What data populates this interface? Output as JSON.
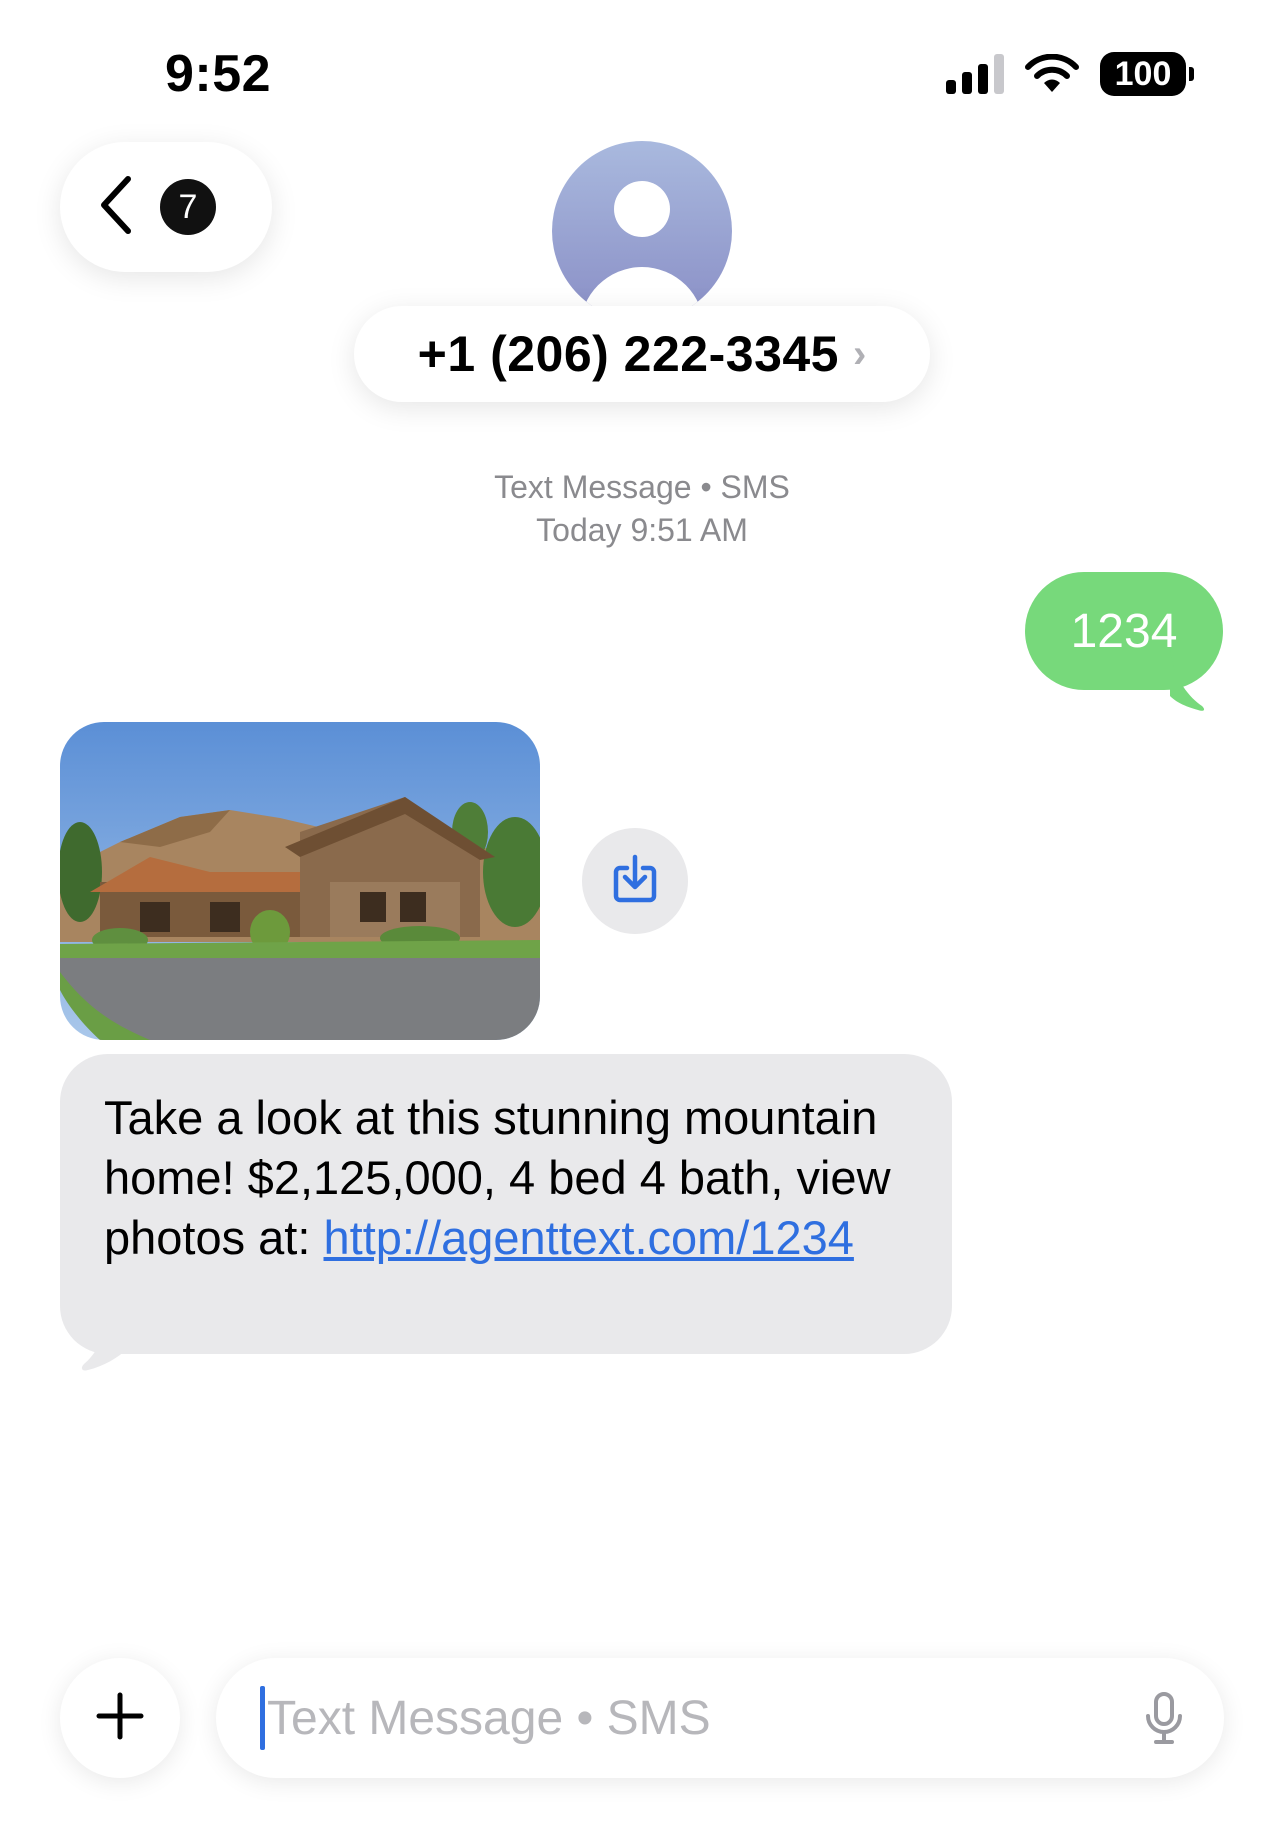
{
  "status_bar": {
    "time": "9:52",
    "battery": "100"
  },
  "header": {
    "unread_count": "7",
    "contact": "+1 (206) 222-3345",
    "chevron": "›"
  },
  "thread": {
    "service_label": "Text Message • SMS",
    "timestamp": "Today 9:51 AM"
  },
  "messages": {
    "sent": "1234",
    "received_text": "Take a look at this stunning mountain home! $2,125,000, 4 bed 4 bath, view photos at: ",
    "received_link": "http://agenttext.com/1234"
  },
  "composer": {
    "placeholder": "Text Message • SMS"
  },
  "colors": {
    "sent_bubble": "#77d97b",
    "received_bubble": "#e9e9eb",
    "link": "#2f6fe0",
    "accent": "#2f6fe0"
  },
  "icons": {
    "back": "chevron-left-icon",
    "avatar": "person-icon",
    "save": "download-icon",
    "add": "plus-icon",
    "mic": "microphone-icon"
  }
}
